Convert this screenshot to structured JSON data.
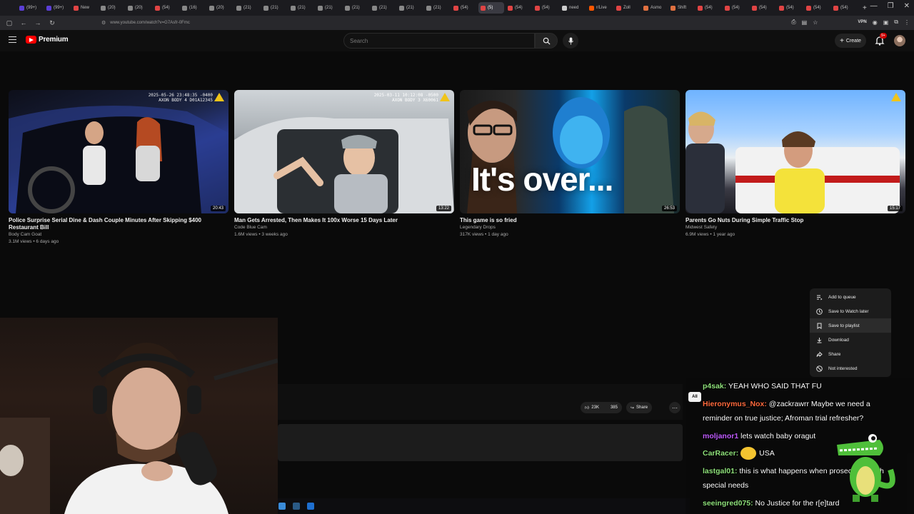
{
  "browser": {
    "tabs": [
      {
        "label": "(99+)",
        "color": "#5b3fd6"
      },
      {
        "label": "(99+)",
        "color": "#5b3fd6"
      },
      {
        "label": "New",
        "color": "#e04444"
      },
      {
        "label": "(20)",
        "color": "#888"
      },
      {
        "label": "(20)",
        "color": "#888"
      },
      {
        "label": "(54)",
        "color": "#e04444"
      },
      {
        "label": "(16)",
        "color": "#888"
      },
      {
        "label": "(20)",
        "color": "#888"
      },
      {
        "label": "(21)",
        "color": "#888"
      },
      {
        "label": "(21)",
        "color": "#888"
      },
      {
        "label": "(21)",
        "color": "#888"
      },
      {
        "label": "(21)",
        "color": "#888"
      },
      {
        "label": "(21)",
        "color": "#888"
      },
      {
        "label": "(21)",
        "color": "#888"
      },
      {
        "label": "(21)",
        "color": "#888"
      },
      {
        "label": "(21)",
        "color": "#888"
      },
      {
        "label": "(54)",
        "color": "#e04444"
      },
      {
        "label": "(5)",
        "color": "#e04444"
      },
      {
        "label": "(54)",
        "color": "#e04444"
      },
      {
        "label": "(54)",
        "color": "#e04444"
      },
      {
        "label": "need",
        "color": "#ccc"
      },
      {
        "label": "r/Live",
        "color": "#ff5700"
      },
      {
        "label": "Zoll",
        "color": "#e04444"
      },
      {
        "label": "Asmo",
        "color": "#e07040"
      },
      {
        "label": "Shift",
        "color": "#e07040"
      },
      {
        "label": "(54)",
        "color": "#e04444"
      },
      {
        "label": "(54)",
        "color": "#e04444"
      },
      {
        "label": "(54)",
        "color": "#e04444"
      },
      {
        "label": "(54)",
        "color": "#e04444"
      },
      {
        "label": "(54)",
        "color": "#e04444"
      },
      {
        "label": "(54)",
        "color": "#e04444"
      }
    ],
    "active_tab_index": 17,
    "url": "www.youtube.com/watch?v=G7Asfr-0Fmc",
    "vpn_label": "VPN"
  },
  "header": {
    "logo_text": "Premium",
    "search_placeholder": "Search",
    "create_label": "Create",
    "notif_count": "9+"
  },
  "videos": [
    {
      "title": "Police Surprise Serial Dine & Dash Couple Minutes After Skipping $400 Restaurant Bill",
      "channel": "Body Cam Goat",
      "meta": "3.1M views • 6 days ago",
      "duration": "20:43",
      "stamp": "2025-05-26 23:48:35 -0400\nAXON BODY 4 D01A12345",
      "overlay": ""
    },
    {
      "title": "Man Gets Arrested, Then Makes It 100x Worse 15 Days Later",
      "channel": "Code Blue Cam",
      "meta": "1.6M views • 3 weeks ago",
      "duration": "13:22",
      "stamp": "2025-03-11 10:12:08 -0500\nAXON BODY 3 X60061",
      "overlay": ""
    },
    {
      "title": "This game is so fried",
      "channel": "Legendary Drops",
      "meta": "317K views • 1 day ago",
      "duration": "26:53",
      "stamp": "",
      "overlay": "It's over..."
    },
    {
      "title": "Parents Go Nuts During Simple Traffic Stop",
      "channel": "Midwest Safety",
      "meta": "6.9M views • 1 year ago",
      "duration": "15:17",
      "stamp": "",
      "overlay": ""
    }
  ],
  "context_menu": {
    "items": [
      {
        "label": "Add to queue",
        "icon": "queue-icon"
      },
      {
        "label": "Save to Watch later",
        "icon": "clock-icon"
      },
      {
        "label": "Save to playlist",
        "icon": "bookmark-icon"
      },
      {
        "label": "Download",
        "icon": "download-icon"
      },
      {
        "label": "Share",
        "icon": "share-icon"
      },
      {
        "label": "Not interested",
        "icon": "block-icon"
      }
    ],
    "hovered_index": 2
  },
  "player": {
    "likes": "23K",
    "dislike_count": "385",
    "share_label": "Share",
    "all_label": "All"
  },
  "chat": [
    {
      "user": "p4sak:",
      "user_color": "#8ee07a",
      "text": "YEAH WHO SAID THAT FU"
    },
    {
      "user": "Hieronymus_Nox:",
      "user_color": "#ff6a3d",
      "text": "@zackrawrr Maybe we need a reminder on true justice; Afroman trial refresher?"
    },
    {
      "user": "moljanor1",
      "user_color": "#c05cff",
      "text": "lets watch baby oragut"
    },
    {
      "user": "CarRacer:",
      "user_color": "#8ee07a",
      "text": "USA"
    },
    {
      "user": "lastgal01:",
      "user_color": "#8ee07a",
      "text": "this is what happens when prosecutors with special needs"
    },
    {
      "user": "seeingred075:",
      "user_color": "#8ee07a",
      "text": "No Justice for the r[e]tard"
    }
  ]
}
